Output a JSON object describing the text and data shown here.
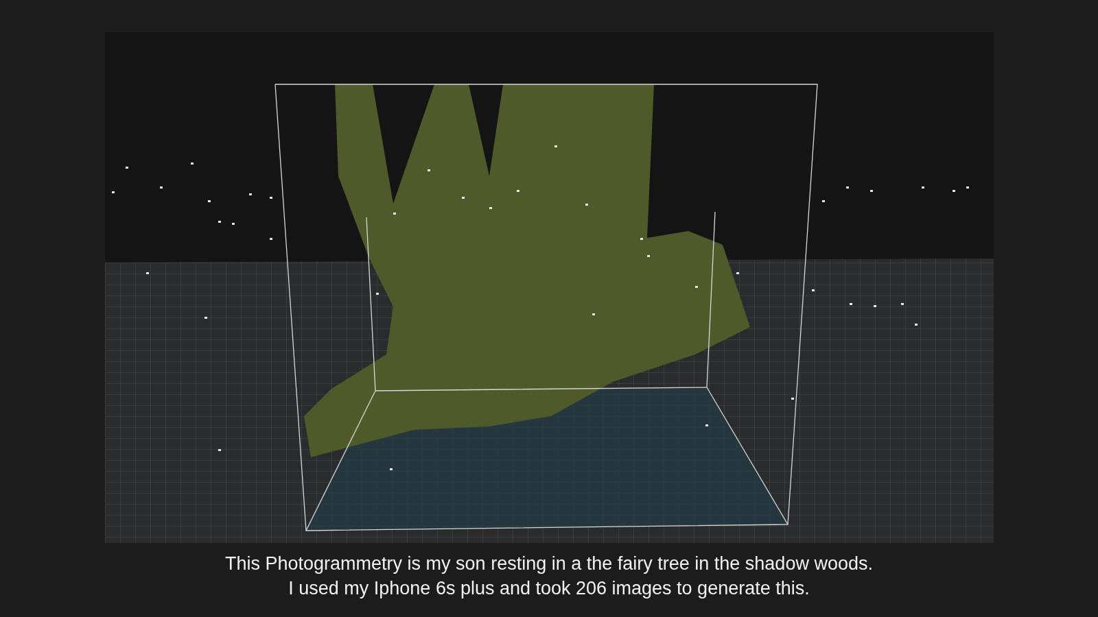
{
  "caption": [
    "This Photogrammetry is my son resting in a the fairy tree in the shadow woods.",
    "I used my Iphone 6s plus and took 206 images to generate this."
  ]
}
